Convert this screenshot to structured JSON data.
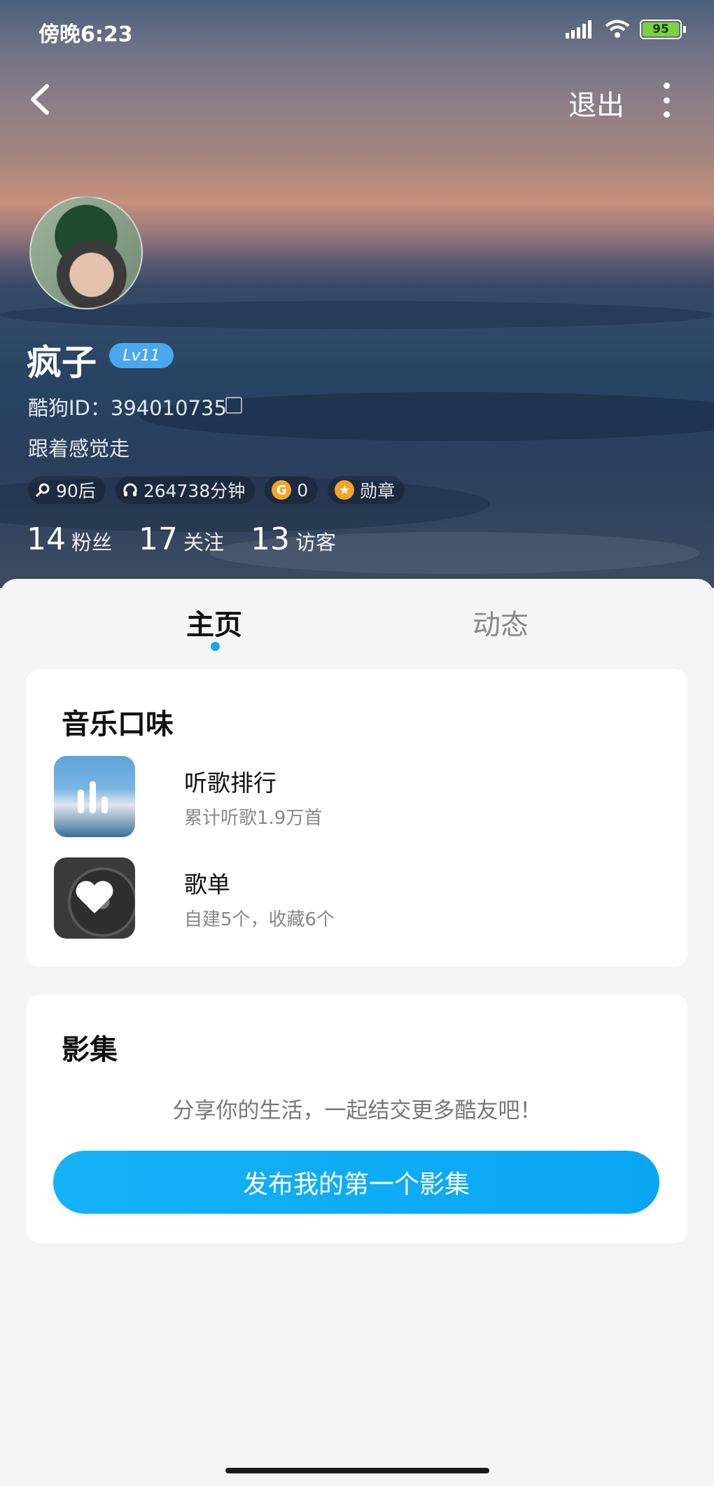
{
  "status_bar": {
    "time": "傍晚6:23",
    "battery": "95"
  },
  "nav": {
    "logout": "退出"
  },
  "profile": {
    "name": "疯子",
    "level": "Lv11",
    "id_text": "酷狗ID：394010735",
    "signature": "跟着感觉走",
    "chips": [
      {
        "icon": "search-icon",
        "label": "90后"
      },
      {
        "icon": "headphones-icon",
        "label": "264738分钟"
      },
      {
        "icon": "coin-icon",
        "label": "0",
        "coin_letter": "G"
      },
      {
        "icon": "medal-icon",
        "label": "勋章"
      }
    ],
    "stats": [
      {
        "num": "14",
        "label": "粉丝"
      },
      {
        "num": "17",
        "label": "关注"
      },
      {
        "num": "13",
        "label": "访客"
      }
    ]
  },
  "tabs": [
    {
      "label": "主页",
      "active": true
    },
    {
      "label": "动态",
      "active": false
    }
  ],
  "music_taste": {
    "title": "音乐口味",
    "items": [
      {
        "title": "听歌排行",
        "subtitle": "累计听歌1.9万首"
      },
      {
        "title": "歌单",
        "subtitle": "自建5个，收藏6个"
      }
    ]
  },
  "album": {
    "title": "影集",
    "hint": "分享你的生活，一起结交更多酷友吧！",
    "button": "发布我的第一个影集"
  },
  "colors": {
    "accent": "#16a8f0",
    "level_badge": "#4aa7ee",
    "coin": "#f3a52a"
  }
}
